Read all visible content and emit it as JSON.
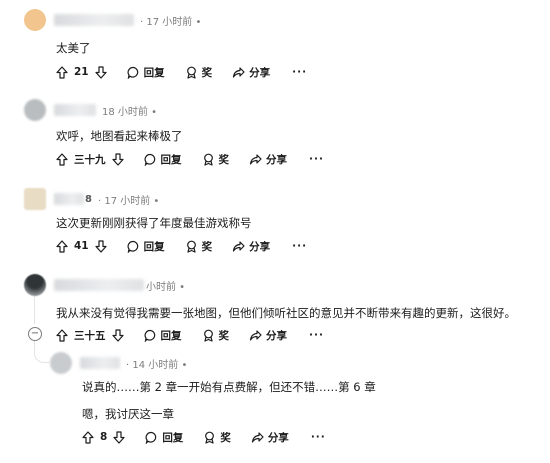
{
  "comments": [
    {
      "time": "17 小时前",
      "body": "太美了",
      "votes": "21",
      "reply": "回复",
      "award": "奖",
      "share": "分享",
      "more": "···",
      "avatar_color": "#f2c58f"
    },
    {
      "time": "18 小时前",
      "body": "欢呼，地图看起来棒极了",
      "votes": "三十九",
      "reply": "回复",
      "award": "奖",
      "share": "分享",
      "more": "···",
      "avatar_color": "#b9bdbf"
    },
    {
      "name_fragment": "8",
      "time": "17 小时前",
      "body": "这次更新刚刚获得了年度最佳游戏称号",
      "votes": "41",
      "reply": "回复",
      "award": "奖",
      "share": "分享",
      "more": "···",
      "avatar_color": "#e8dcc4"
    },
    {
      "time": "小时前",
      "body": "我从来没有觉得我需要一张地图，但他们倾听社区的意见并不断带来有趣的更新，这很好。",
      "votes": "三十五",
      "reply": "回复",
      "award": "奖",
      "share": "分享",
      "more": "···",
      "avatar_color": "#6b6f72",
      "collapse": "−"
    },
    {
      "time": "14 小时前",
      "body_lines": [
        "说真的……第 2 章一开始有点费解，但还不错……第 6 章",
        "嗯，我讨厌这一章"
      ],
      "votes": "8",
      "reply": "回复",
      "award": "奖",
      "share": "分享",
      "more": "···",
      "avatar_color": "#c9cccf"
    }
  ]
}
